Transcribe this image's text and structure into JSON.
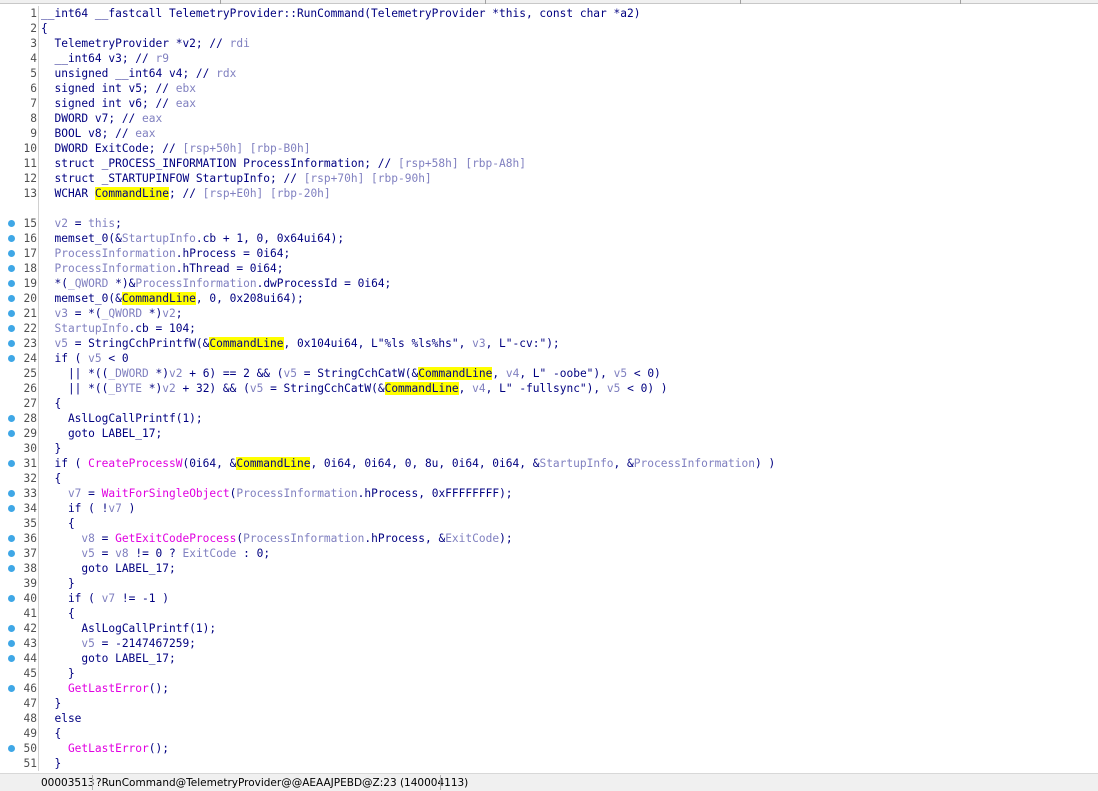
{
  "colors": {
    "default": "#000080",
    "gray": "#8080c0",
    "function": "#e000e0",
    "highlight": "#ffff00",
    "breakpoint_dot": "#3fa7e6",
    "line_number": "#505050"
  },
  "code": {
    "lines": [
      {
        "n": "1",
        "dot": false,
        "segs": [
          [
            "d",
            "__int64 __fastcall TelemetryProvider::RunCommand(TelemetryProvider *this, const char *a2)"
          ]
        ]
      },
      {
        "n": "2",
        "dot": false,
        "segs": [
          [
            "d",
            "{"
          ]
        ]
      },
      {
        "n": "3",
        "dot": false,
        "segs": [
          [
            "d",
            "  TelemetryProvider *v2; // "
          ],
          [
            "g",
            "rdi"
          ]
        ]
      },
      {
        "n": "4",
        "dot": false,
        "segs": [
          [
            "d",
            "  __int64 v3; // "
          ],
          [
            "g",
            "r9"
          ]
        ]
      },
      {
        "n": "5",
        "dot": false,
        "segs": [
          [
            "d",
            "  unsigned __int64 v4; // "
          ],
          [
            "g",
            "rdx"
          ]
        ]
      },
      {
        "n": "6",
        "dot": false,
        "segs": [
          [
            "d",
            "  signed int v5; // "
          ],
          [
            "g",
            "ebx"
          ]
        ]
      },
      {
        "n": "7",
        "dot": false,
        "segs": [
          [
            "d",
            "  signed int v6; // "
          ],
          [
            "g",
            "eax"
          ]
        ]
      },
      {
        "n": "8",
        "dot": false,
        "segs": [
          [
            "d",
            "  DWORD v7; // "
          ],
          [
            "g",
            "eax"
          ]
        ]
      },
      {
        "n": "9",
        "dot": false,
        "segs": [
          [
            "d",
            "  BOOL v8; // "
          ],
          [
            "g",
            "eax"
          ]
        ]
      },
      {
        "n": "10",
        "dot": false,
        "segs": [
          [
            "d",
            "  DWORD ExitCode; // "
          ],
          [
            "g",
            "[rsp+50h] [rbp-B0h]"
          ]
        ]
      },
      {
        "n": "11",
        "dot": false,
        "segs": [
          [
            "d",
            "  struct _PROCESS_INFORMATION ProcessInformation; // "
          ],
          [
            "g",
            "[rsp+58h] [rbp-A8h]"
          ]
        ]
      },
      {
        "n": "12",
        "dot": false,
        "segs": [
          [
            "d",
            "  struct _STARTUPINFOW StartupInfo; // "
          ],
          [
            "g",
            "[rsp+70h] [rbp-90h]"
          ]
        ]
      },
      {
        "n": "13",
        "dot": false,
        "segs": [
          [
            "d",
            "  WCHAR "
          ],
          [
            "h",
            "CommandLine"
          ],
          [
            "d",
            "; // "
          ],
          [
            "g",
            "[rsp+E0h] [rbp-20h]"
          ]
        ]
      },
      {
        "n": "",
        "dot": false,
        "segs": []
      },
      {
        "n": "15",
        "dot": true,
        "segs": [
          [
            "g",
            "  v2"
          ],
          [
            "d",
            " = "
          ],
          [
            "g",
            "this"
          ],
          [
            "d",
            ";"
          ]
        ]
      },
      {
        "n": "16",
        "dot": true,
        "segs": [
          [
            "d",
            "  memset_0(&"
          ],
          [
            "g",
            "StartupInfo"
          ],
          [
            "d",
            ".cb + 1, 0, 0x64ui64);"
          ]
        ]
      },
      {
        "n": "17",
        "dot": true,
        "segs": [
          [
            "g",
            "  ProcessInformation"
          ],
          [
            "d",
            ".hProcess = 0i64;"
          ]
        ]
      },
      {
        "n": "18",
        "dot": true,
        "segs": [
          [
            "g",
            "  ProcessInformation"
          ],
          [
            "d",
            ".hThread = 0i64;"
          ]
        ]
      },
      {
        "n": "19",
        "dot": true,
        "segs": [
          [
            "d",
            "  *("
          ],
          [
            "g",
            "_QWORD"
          ],
          [
            "d",
            " *)&"
          ],
          [
            "g",
            "ProcessInformation"
          ],
          [
            "d",
            ".dwProcessId = 0i64;"
          ]
        ]
      },
      {
        "n": "20",
        "dot": true,
        "segs": [
          [
            "d",
            "  memset_0(&"
          ],
          [
            "h",
            "CommandLine"
          ],
          [
            "d",
            ", 0, 0x208ui64);"
          ]
        ]
      },
      {
        "n": "21",
        "dot": true,
        "segs": [
          [
            "g",
            "  v3"
          ],
          [
            "d",
            " = *("
          ],
          [
            "g",
            "_QWORD"
          ],
          [
            "d",
            " *)"
          ],
          [
            "g",
            "v2"
          ],
          [
            "d",
            ";"
          ]
        ]
      },
      {
        "n": "22",
        "dot": true,
        "segs": [
          [
            "g",
            "  StartupInfo"
          ],
          [
            "d",
            ".cb = 104;"
          ]
        ]
      },
      {
        "n": "23",
        "dot": true,
        "segs": [
          [
            "g",
            "  v5"
          ],
          [
            "d",
            " = StringCchPrintfW(&"
          ],
          [
            "h",
            "CommandLine"
          ],
          [
            "d",
            ", 0x104ui64, L\"%ls %ls%hs\", "
          ],
          [
            "g",
            "v3"
          ],
          [
            "d",
            ", L\"-cv:\");"
          ]
        ]
      },
      {
        "n": "24",
        "dot": true,
        "segs": [
          [
            "d",
            "  if ( "
          ],
          [
            "g",
            "v5"
          ],
          [
            "d",
            " < 0"
          ]
        ]
      },
      {
        "n": "25",
        "dot": false,
        "segs": [
          [
            "d",
            "    || *(("
          ],
          [
            "g",
            "_DWORD"
          ],
          [
            "d",
            " *)"
          ],
          [
            "g",
            "v2"
          ],
          [
            "d",
            " + 6) == 2 && ("
          ],
          [
            "g",
            "v5"
          ],
          [
            "d",
            " = StringCchCatW(&"
          ],
          [
            "h",
            "CommandLine"
          ],
          [
            "d",
            ", "
          ],
          [
            "g",
            "v4"
          ],
          [
            "d",
            ", L\" -oobe\"), "
          ],
          [
            "g",
            "v5"
          ],
          [
            "d",
            " < 0)"
          ]
        ]
      },
      {
        "n": "26",
        "dot": false,
        "segs": [
          [
            "d",
            "    || *(("
          ],
          [
            "g",
            "_BYTE"
          ],
          [
            "d",
            " *)"
          ],
          [
            "g",
            "v2"
          ],
          [
            "d",
            " + 32) && ("
          ],
          [
            "g",
            "v5"
          ],
          [
            "d",
            " = StringCchCatW(&"
          ],
          [
            "h",
            "CommandLine"
          ],
          [
            "d",
            ", "
          ],
          [
            "g",
            "v4"
          ],
          [
            "d",
            ", L\" -fullsync\"), "
          ],
          [
            "g",
            "v5"
          ],
          [
            "d",
            " < 0) )"
          ]
        ]
      },
      {
        "n": "27",
        "dot": false,
        "segs": [
          [
            "d",
            "  {"
          ]
        ]
      },
      {
        "n": "28",
        "dot": true,
        "segs": [
          [
            "d",
            "    AslLogCallPrintf(1);"
          ]
        ]
      },
      {
        "n": "29",
        "dot": true,
        "segs": [
          [
            "d",
            "    goto LABEL_17;"
          ]
        ]
      },
      {
        "n": "30",
        "dot": false,
        "segs": [
          [
            "d",
            "  }"
          ]
        ]
      },
      {
        "n": "31",
        "dot": true,
        "segs": [
          [
            "d",
            "  if ( "
          ],
          [
            "f",
            "CreateProcessW"
          ],
          [
            "d",
            "(0i64, &"
          ],
          [
            "h",
            "CommandLine"
          ],
          [
            "d",
            ", 0i64, 0i64, 0, 8u, 0i64, 0i64, &"
          ],
          [
            "g",
            "StartupInfo"
          ],
          [
            "d",
            ", &"
          ],
          [
            "g",
            "ProcessInformation"
          ],
          [
            "d",
            ") )"
          ]
        ]
      },
      {
        "n": "32",
        "dot": false,
        "segs": [
          [
            "d",
            "  {"
          ]
        ]
      },
      {
        "n": "33",
        "dot": true,
        "segs": [
          [
            "g",
            "    v7"
          ],
          [
            "d",
            " = "
          ],
          [
            "f",
            "WaitForSingleObject"
          ],
          [
            "d",
            "("
          ],
          [
            "g",
            "ProcessInformation"
          ],
          [
            "d",
            ".hProcess, 0xFFFFFFFF);"
          ]
        ]
      },
      {
        "n": "34",
        "dot": true,
        "segs": [
          [
            "d",
            "    if ( !"
          ],
          [
            "g",
            "v7"
          ],
          [
            "d",
            " )"
          ]
        ]
      },
      {
        "n": "35",
        "dot": false,
        "segs": [
          [
            "d",
            "    {"
          ]
        ]
      },
      {
        "n": "36",
        "dot": true,
        "segs": [
          [
            "g",
            "      v8"
          ],
          [
            "d",
            " = "
          ],
          [
            "f",
            "GetExitCodeProcess"
          ],
          [
            "d",
            "("
          ],
          [
            "g",
            "ProcessInformation"
          ],
          [
            "d",
            ".hProcess, &"
          ],
          [
            "g",
            "ExitCode"
          ],
          [
            "d",
            ");"
          ]
        ]
      },
      {
        "n": "37",
        "dot": true,
        "segs": [
          [
            "g",
            "      v5"
          ],
          [
            "d",
            " = "
          ],
          [
            "g",
            "v8"
          ],
          [
            "d",
            " != 0 ? "
          ],
          [
            "g",
            "ExitCode"
          ],
          [
            "d",
            " : 0;"
          ]
        ]
      },
      {
        "n": "38",
        "dot": true,
        "segs": [
          [
            "d",
            "      goto LABEL_17;"
          ]
        ]
      },
      {
        "n": "39",
        "dot": false,
        "segs": [
          [
            "d",
            "    }"
          ]
        ]
      },
      {
        "n": "40",
        "dot": true,
        "segs": [
          [
            "d",
            "    if ( "
          ],
          [
            "g",
            "v7"
          ],
          [
            "d",
            " != -1 )"
          ]
        ]
      },
      {
        "n": "41",
        "dot": false,
        "segs": [
          [
            "d",
            "    {"
          ]
        ]
      },
      {
        "n": "42",
        "dot": true,
        "segs": [
          [
            "d",
            "      AslLogCallPrintf(1);"
          ]
        ]
      },
      {
        "n": "43",
        "dot": true,
        "segs": [
          [
            "g",
            "      v5"
          ],
          [
            "d",
            " = -2147467259;"
          ]
        ]
      },
      {
        "n": "44",
        "dot": true,
        "segs": [
          [
            "d",
            "      goto LABEL_17;"
          ]
        ]
      },
      {
        "n": "45",
        "dot": false,
        "segs": [
          [
            "d",
            "    }"
          ]
        ]
      },
      {
        "n": "46",
        "dot": true,
        "segs": [
          [
            "f",
            "    GetLastError"
          ],
          [
            "d",
            "();"
          ]
        ]
      },
      {
        "n": "47",
        "dot": false,
        "segs": [
          [
            "d",
            "  }"
          ]
        ]
      },
      {
        "n": "48",
        "dot": false,
        "segs": [
          [
            "d",
            "  else"
          ]
        ]
      },
      {
        "n": "49",
        "dot": false,
        "segs": [
          [
            "d",
            "  {"
          ]
        ]
      },
      {
        "n": "50",
        "dot": true,
        "segs": [
          [
            "f",
            "    GetLastError"
          ],
          [
            "d",
            "();"
          ]
        ]
      },
      {
        "n": "51",
        "dot": false,
        "segs": [
          [
            "d",
            "  }"
          ]
        ]
      }
    ]
  },
  "status": {
    "address": "00003513",
    "location": "?RunCommand@TelemetryProvider@@AEAAJPEBD@Z:23 (140004113)"
  }
}
